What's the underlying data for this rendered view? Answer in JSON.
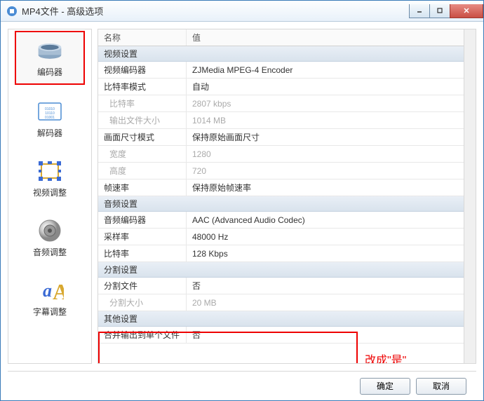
{
  "window": {
    "title": "MP4文件 - 高级选项"
  },
  "sidebar": {
    "items": [
      {
        "label": "编码器",
        "icon": "encoder-icon"
      },
      {
        "label": "解码器",
        "icon": "decoder-icon"
      },
      {
        "label": "视频调整",
        "icon": "video-adjust-icon"
      },
      {
        "label": "音频调整",
        "icon": "audio-adjust-icon"
      },
      {
        "label": "字幕调整",
        "icon": "subtitle-adjust-icon"
      }
    ]
  },
  "table": {
    "header_name": "名称",
    "header_value": "值",
    "sections": [
      {
        "title": "视频设置",
        "rows": [
          {
            "name": "视频编码器",
            "value": "ZJMedia MPEG-4 Encoder",
            "disabled": false
          },
          {
            "name": "比特率模式",
            "value": "自动",
            "disabled": false
          },
          {
            "name": "比特率",
            "value": "2807 kbps",
            "disabled": true
          },
          {
            "name": "输出文件大小",
            "value": "1014 MB",
            "disabled": true
          },
          {
            "name": "画面尺寸模式",
            "value": "保持原始画面尺寸",
            "disabled": false
          },
          {
            "name": "宽度",
            "value": "1280",
            "disabled": true
          },
          {
            "name": "高度",
            "value": "720",
            "disabled": true
          },
          {
            "name": "帧速率",
            "value": "保持原始帧速率",
            "disabled": false
          }
        ]
      },
      {
        "title": "音频设置",
        "rows": [
          {
            "name": "音频编码器",
            "value": "AAC (Advanced Audio Codec)",
            "disabled": false
          },
          {
            "name": "采样率",
            "value": "48000 Hz",
            "disabled": false
          },
          {
            "name": "比特率",
            "value": "128 Kbps",
            "disabled": false
          }
        ]
      },
      {
        "title": "分割设置",
        "rows": [
          {
            "name": "分割文件",
            "value": "否",
            "disabled": false
          },
          {
            "name": "分割大小",
            "value": "20 MB",
            "disabled": true
          }
        ]
      },
      {
        "title": "其他设置",
        "rows": [
          {
            "name": "合并输出到单个文件",
            "value": "否",
            "disabled": false
          }
        ]
      }
    ]
  },
  "annotation": {
    "text": "改成\"是\""
  },
  "footer": {
    "ok": "确定",
    "cancel": "取消"
  }
}
